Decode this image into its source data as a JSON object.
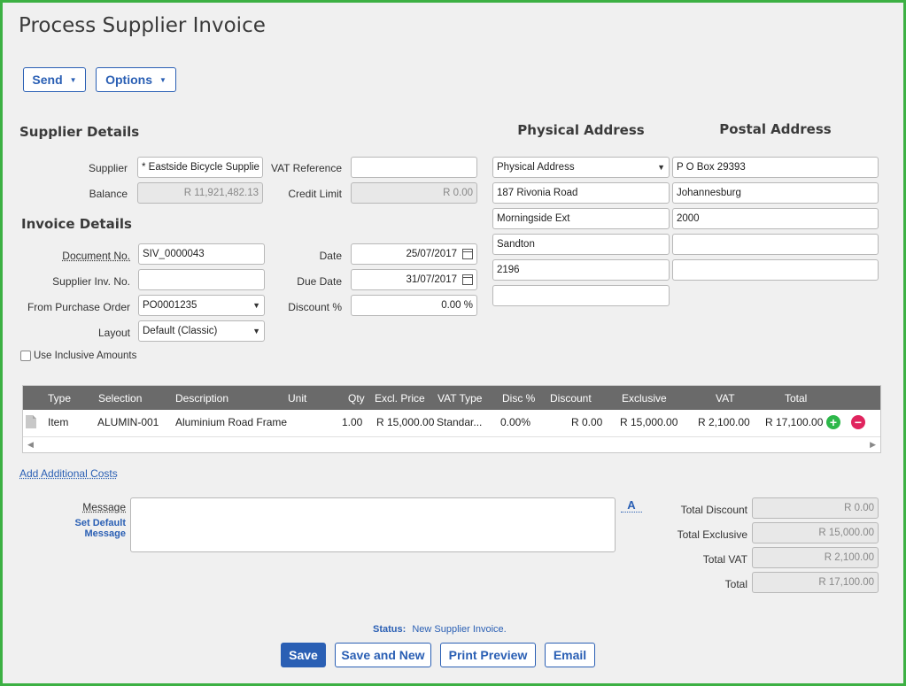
{
  "page": {
    "title": "Process Supplier Invoice"
  },
  "toolbar": {
    "send_label": "Send",
    "options_label": "Options"
  },
  "supplier_details": {
    "heading": "Supplier Details",
    "supplier_label": "Supplier",
    "supplier_value": "* Eastside Bicycle Supplie",
    "balance_label": "Balance",
    "balance_value": "R 11,921,482.13",
    "vat_ref_label": "VAT Reference",
    "vat_ref_value": "",
    "credit_limit_label": "Credit Limit",
    "credit_limit_value": "R 0.00"
  },
  "invoice_details": {
    "heading": "Invoice Details",
    "doc_no_label": "Document No.",
    "doc_no_value": "SIV_0000043",
    "supplier_inv_label": "Supplier Inv. No.",
    "supplier_inv_value": "",
    "purchase_order_label": "From Purchase Order",
    "purchase_order_value": "PO0001235",
    "layout_label": "Layout",
    "layout_value": "Default (Classic)",
    "date_label": "Date",
    "date_value": "25/07/2017",
    "due_date_label": "Due Date",
    "due_date_value": "31/07/2017",
    "discount_label": "Discount %",
    "discount_value": "0.00 %",
    "inclusive_label": "Use Inclusive Amounts"
  },
  "physical_address": {
    "heading": "Physical Address",
    "type_value": "Physical Address",
    "lines": [
      "187 Rivonia Road",
      "Morningside Ext",
      "Sandton",
      "2196",
      ""
    ]
  },
  "postal_address": {
    "heading": "Postal Address",
    "lines": [
      "P O Box 29393",
      "Johannesburg",
      "2000",
      "",
      ""
    ]
  },
  "grid": {
    "columns": [
      "Type",
      "Selection",
      "Description",
      "Unit",
      "Qty",
      "Excl. Price",
      "VAT Type",
      "Disc %",
      "Discount",
      "Exclusive",
      "VAT",
      "Total"
    ],
    "rows": [
      {
        "type": "Item",
        "selection": "ALUMIN-001",
        "description": "Aluminium Road Frame",
        "unit": "",
        "qty": "1.00",
        "excl_price": "R 15,000.00",
        "vat_type": "Standar...",
        "disc_pct": "0.00%",
        "discount": "R 0.00",
        "exclusive": "R 15,000.00",
        "vat": "R 2,100.00",
        "total": "R 17,100.00"
      }
    ]
  },
  "links": {
    "additional_costs": "Add Additional Costs",
    "set_default_message": "Set Default Message"
  },
  "message": {
    "label": "Message",
    "value": "",
    "font_glyph": "A"
  },
  "totals": {
    "discount_label": "Total Discount",
    "discount_value": "R 0.00",
    "exclusive_label": "Total Exclusive",
    "exclusive_value": "R 15,000.00",
    "vat_label": "Total VAT",
    "vat_value": "R 2,100.00",
    "total_label": "Total",
    "total_value": "R 17,100.00"
  },
  "status": {
    "label": "Status:",
    "value": "New Supplier Invoice."
  },
  "actions": {
    "save": "Save",
    "save_new": "Save and New",
    "print_preview": "Print Preview",
    "email": "Email"
  },
  "colors": {
    "accent": "#2a5fb4",
    "frame": "#3cb043",
    "add": "#2db84a",
    "remove": "#e0245e"
  },
  "icons": {
    "add": "plus-circle-icon",
    "remove": "minus-circle-icon",
    "document": "document-icon",
    "calendar": "calendar-icon"
  }
}
